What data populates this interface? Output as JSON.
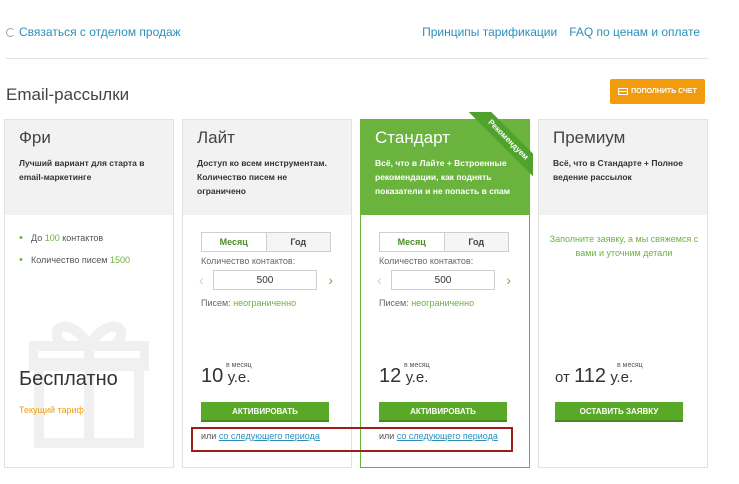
{
  "header": {
    "contact_label": "Связаться с отделом продаж",
    "links": [
      "Принципы тарификации",
      "FAQ по ценам и оплате"
    ]
  },
  "section": {
    "title": "Email-рассылки",
    "topup_label": "пополнить счет"
  },
  "plans": {
    "free": {
      "name": "Фри",
      "desc": "Лучший вариант для старта в email-маркетинге",
      "features": [
        {
          "prefix": "До ",
          "value": "100",
          "suffix": " контактов"
        },
        {
          "prefix": "Количество писем ",
          "value": "1500",
          "suffix": ""
        }
      ],
      "price": "Бесплатно",
      "current": "Текущий тариф"
    },
    "lite": {
      "name": "Лайт",
      "desc": "Доступ ко всем инструментам. Количество писем не ограничено",
      "toggle": [
        "Месяц",
        "Год"
      ],
      "contacts_label": "Количество контактов:",
      "contacts_value": "500",
      "letters_label": "Писем: ",
      "letters_value": "неограниченно",
      "price": "10",
      "unit": "у.е.",
      "per": "в месяц",
      "button": "активировать",
      "next_prefix": "или ",
      "next_link": "со следующего периода"
    },
    "standard": {
      "name": "Стандарт",
      "desc": "Всё, что в Лайте + Встроенные рекомендации, как поднять показатели и не попасть в спам",
      "ribbon": "Рекомендуем",
      "toggle": [
        "Месяц",
        "Год"
      ],
      "contacts_label": "Количество контактов:",
      "contacts_value": "500",
      "letters_label": "Писем: ",
      "letters_value": "неограниченно",
      "price": "12",
      "unit": "у.е.",
      "per": "в месяц",
      "button": "активировать",
      "next_prefix": "или ",
      "next_link": "со следующего периода"
    },
    "premium": {
      "name": "Премиум",
      "desc": "Всё, что в Стандарте + Полное ведение рассылок",
      "note": "Заполните заявку, а мы свяжемся с вами и уточним детали",
      "price_prefix": "от ",
      "price": "112",
      "unit": "у.е.",
      "per": "в месяц",
      "button": "оставить заявку"
    }
  },
  "colors": {
    "accent_green": "#6ab43e",
    "button_green": "#5aa827",
    "orange": "#f29c0d",
    "link_blue": "#2a8fbd",
    "highlight_red": "#9e1c1c"
  }
}
